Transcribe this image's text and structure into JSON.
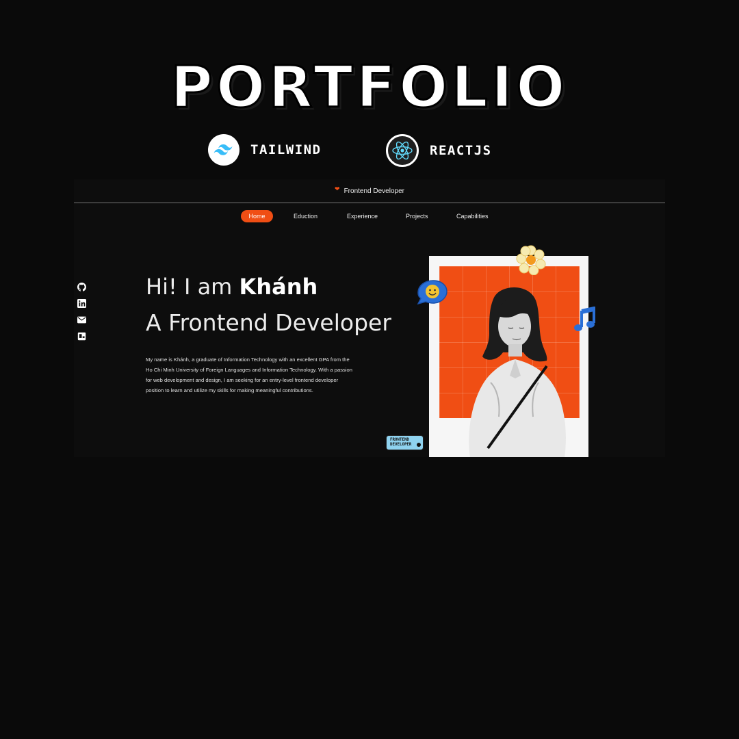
{
  "poster": {
    "title": "PORTFOLIO",
    "tech": [
      {
        "label": "TAILWIND",
        "icon": "tailwind-icon"
      },
      {
        "label": "REACTJS",
        "icon": "react-icon"
      }
    ]
  },
  "site": {
    "topbar": {
      "heart_icon": "heart-icon",
      "text": "Frontend Developer"
    },
    "nav": [
      {
        "label": "Home",
        "active": true
      },
      {
        "label": "Eduction"
      },
      {
        "label": "Experience"
      },
      {
        "label": "Projects"
      },
      {
        "label": "Capabilities"
      }
    ],
    "socials": [
      "github-icon",
      "linkedin-icon",
      "mail-icon",
      "resume-icon"
    ],
    "hero": {
      "greeting": "Hi! I am ",
      "name": "Khánh",
      "role": "A Frontend Developer",
      "bio": [
        "My name is Khánh, a graduate of Information Technology with an excellent GPA from the",
        "Ho Chi Minh University of Foreign Languages and Information Technology. With a passion",
        "for web development and design, I am seeking for an entry-level frontend developer",
        "position to learn and utilize my skills for making meaningful contributions."
      ],
      "tag": [
        "FRONTEND",
        "DEVELOPER"
      ]
    },
    "colors": {
      "accent": "#f04e14",
      "tag": "#8fd3f0",
      "background": "#0d0d0d"
    }
  }
}
